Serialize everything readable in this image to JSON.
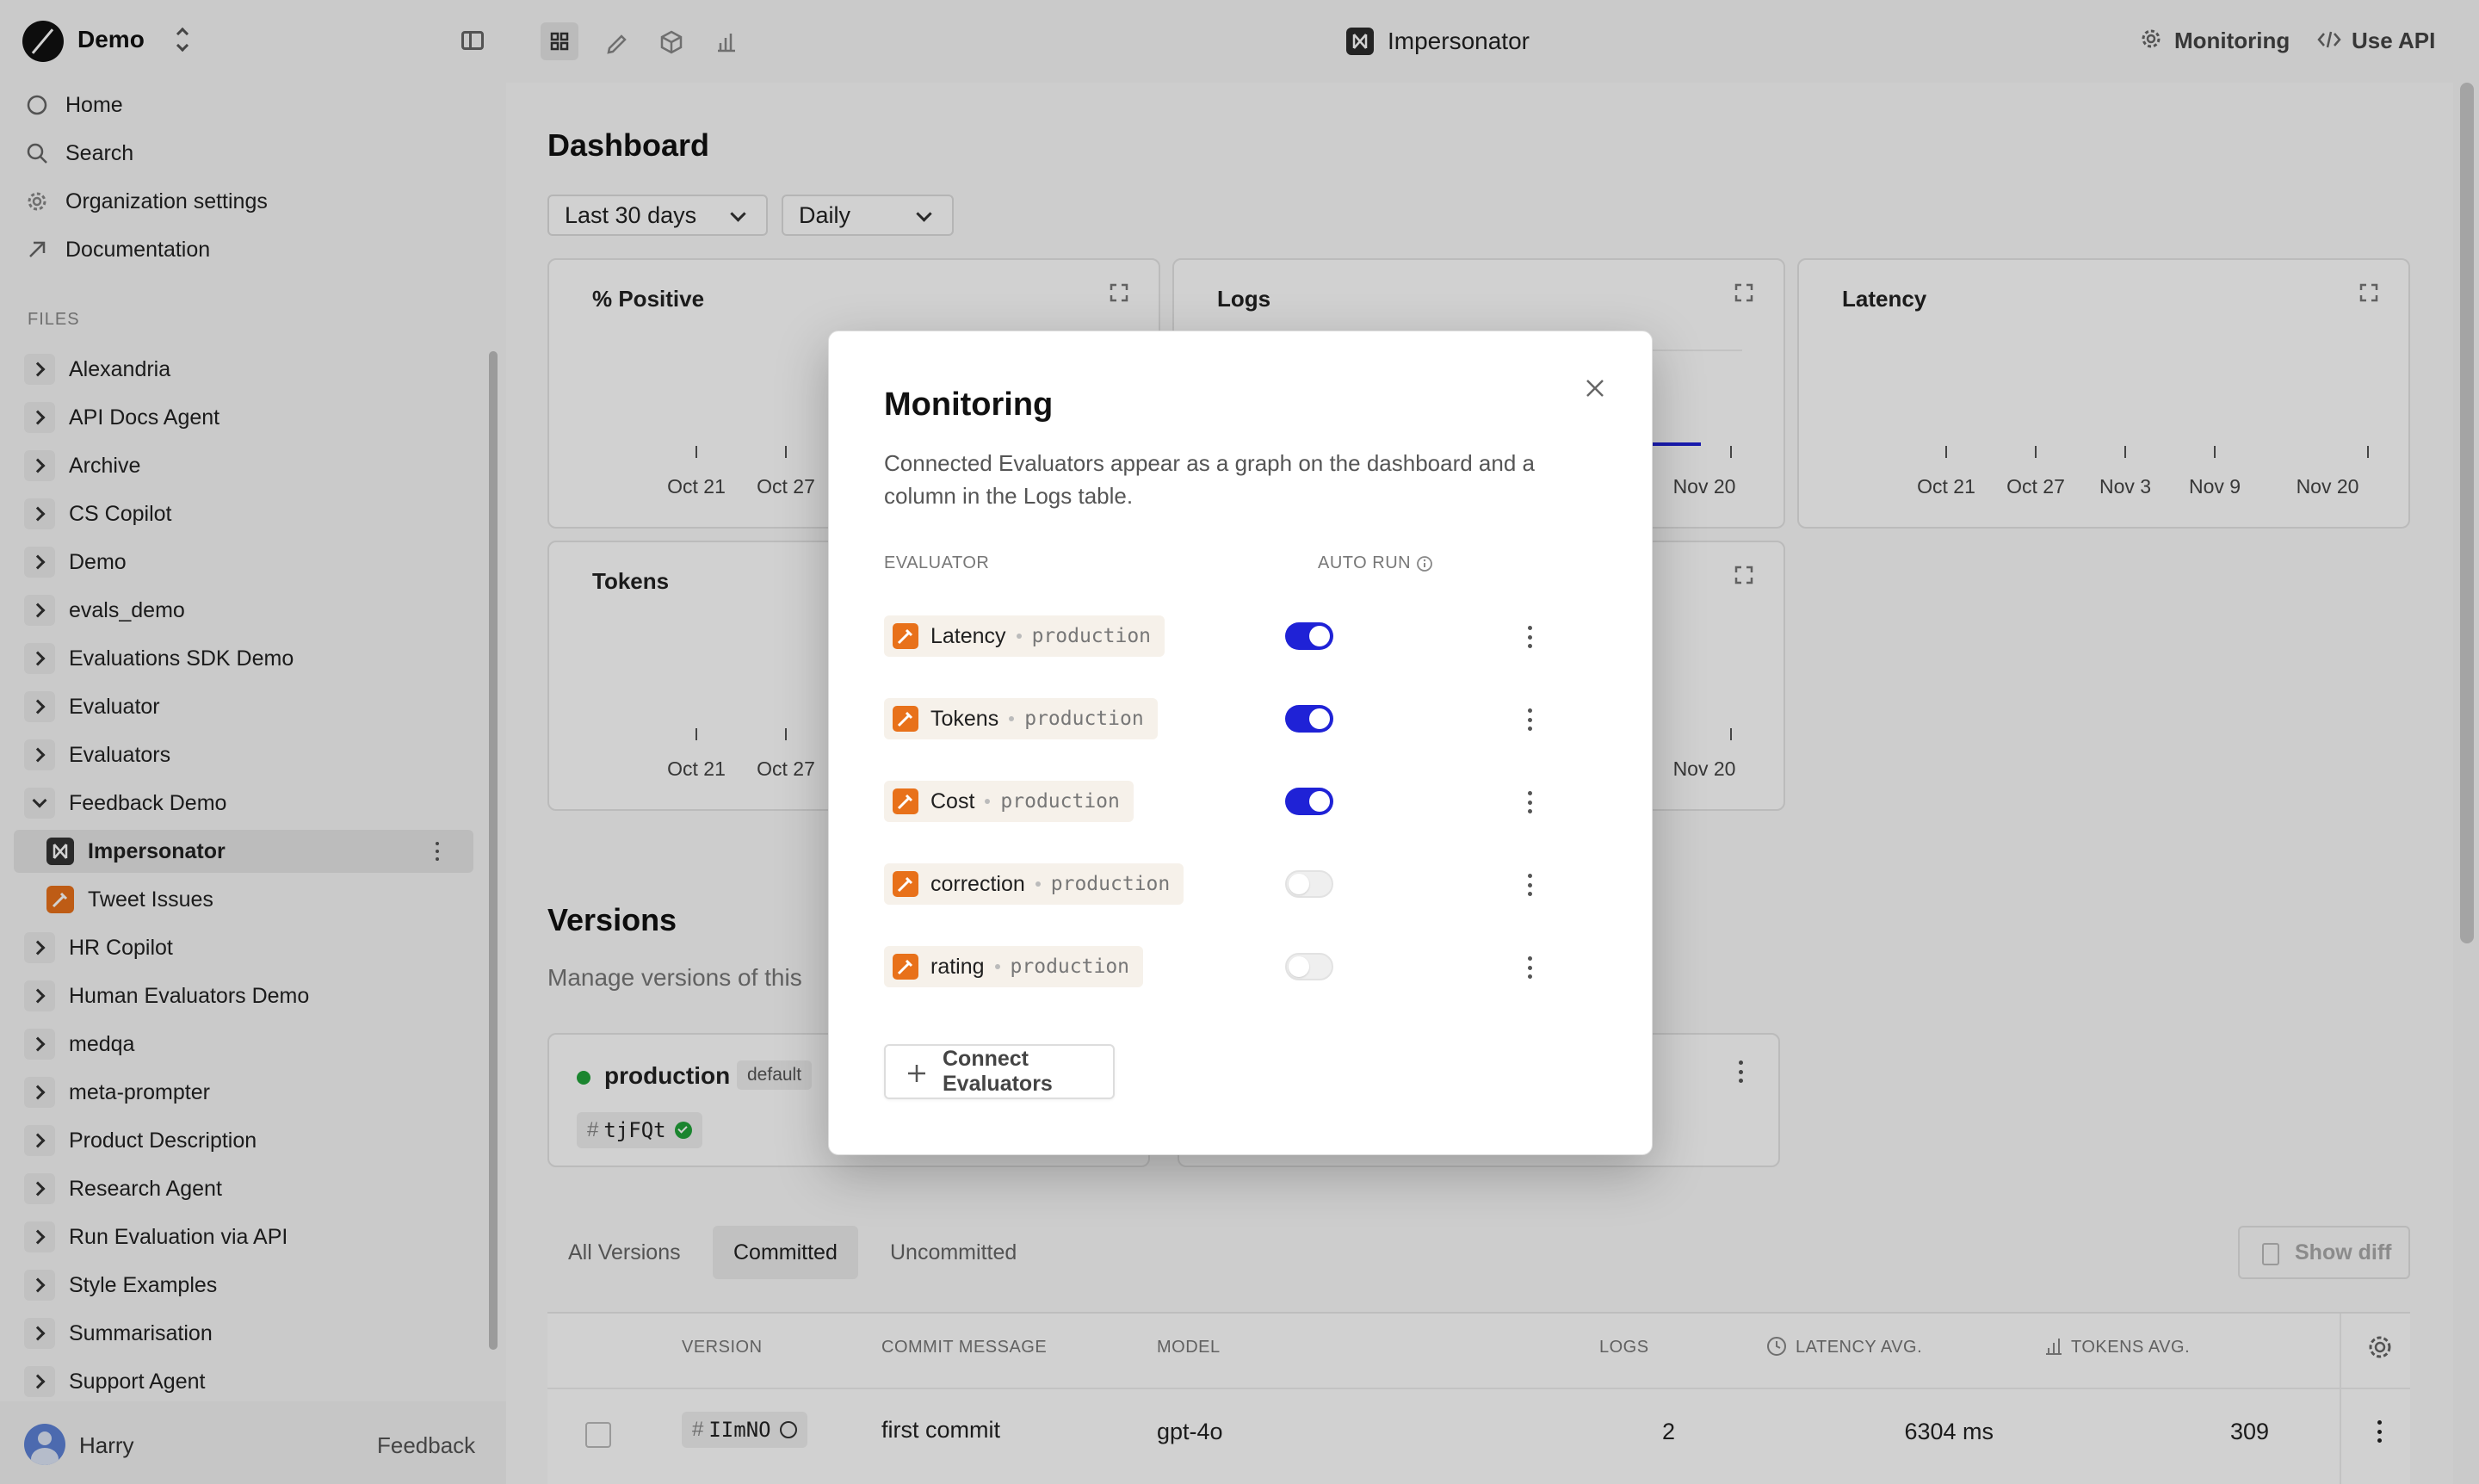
{
  "workspace": {
    "name": "Demo"
  },
  "nav": [
    {
      "label": "Home",
      "icon": "circle-icon"
    },
    {
      "label": "Search",
      "icon": "search-icon"
    },
    {
      "label": "Organization settings",
      "icon": "gear-icon"
    },
    {
      "label": "Documentation",
      "icon": "arrow-up-right-icon"
    }
  ],
  "files_header": "FILES",
  "files": [
    {
      "label": "Alexandria"
    },
    {
      "label": "API Docs Agent"
    },
    {
      "label": "Archive"
    },
    {
      "label": "CS Copilot"
    },
    {
      "label": "Demo"
    },
    {
      "label": "evals_demo"
    },
    {
      "label": "Evaluations SDK Demo"
    },
    {
      "label": "Evaluator"
    },
    {
      "label": "Evaluators"
    },
    {
      "label": "Feedback Demo",
      "expanded": true
    },
    {
      "label": "Impersonator",
      "child": true,
      "selected": true,
      "icon": "prompt-icon"
    },
    {
      "label": "Tweet Issues",
      "child": true,
      "icon": "evaluator-icon"
    },
    {
      "label": "HR Copilot"
    },
    {
      "label": "Human Evaluators Demo"
    },
    {
      "label": "medqa"
    },
    {
      "label": "meta-prompter"
    },
    {
      "label": "Product Description"
    },
    {
      "label": "Research Agent"
    },
    {
      "label": "Run Evaluation via API"
    },
    {
      "label": "Style Examples"
    },
    {
      "label": "Summarisation"
    },
    {
      "label": "Support Agent"
    }
  ],
  "user": {
    "name": "Harry",
    "feedback_label": "Feedback"
  },
  "topbar": {
    "title": "Impersonator",
    "monitoring_label": "Monitoring",
    "api_label": "Use API"
  },
  "dashboard": {
    "title": "Dashboard",
    "range": "Last 30 days",
    "interval": "Daily",
    "cards": [
      {
        "title": "% Positive",
        "ticks": [
          "Oct 21",
          "Oct 27"
        ]
      },
      {
        "title": "Logs",
        "ticks": [
          "Nov 20"
        ]
      },
      {
        "title": "Latency",
        "ticks": [
          "Oct 21",
          "Oct 27",
          "Nov 3",
          "Nov 9",
          "Nov 20"
        ]
      },
      {
        "title": "Tokens",
        "ticks": [
          "Oct 21",
          "Oct 27"
        ]
      },
      {
        "title": "",
        "ticks": [
          "Nov 20"
        ]
      }
    ]
  },
  "versions": {
    "title": "Versions",
    "subtitle": "Manage versions of this",
    "deployment": {
      "name": "production",
      "badge": "default",
      "hash": "tjFQt"
    },
    "tabs": [
      "All Versions",
      "Committed",
      "Uncommitted"
    ],
    "active_tab": "Committed",
    "show_diff": "Show diff",
    "columns": [
      "VERSION",
      "COMMIT MESSAGE",
      "MODEL",
      "LOGS",
      "LATENCY AVG.",
      "TOKENS AVG."
    ],
    "rows": [
      {
        "version": "IImNO",
        "message": "first commit",
        "model": "gpt-4o",
        "logs": "2",
        "latency": "6304 ms",
        "tokens": "309"
      }
    ]
  },
  "modal": {
    "title": "Monitoring",
    "description_line1": "Connected Evaluators appear as a graph on the dashboard and a",
    "description_line2": "column in the Logs table.",
    "col_evaluator": "EVALUATOR",
    "col_autorun": "AUTO RUN",
    "evaluators": [
      {
        "name": "Latency",
        "env": "production",
        "auto_run": true
      },
      {
        "name": "Tokens",
        "env": "production",
        "auto_run": true
      },
      {
        "name": "Cost",
        "env": "production",
        "auto_run": true
      },
      {
        "name": "correction",
        "env": "production",
        "auto_run": false
      },
      {
        "name": "rating",
        "env": "production",
        "auto_run": false
      }
    ],
    "connect_label": "Connect Evaluators"
  },
  "colors": {
    "accent": "#1f22d6",
    "evaluator": "#e8711a",
    "status_green": "#22a33a"
  }
}
